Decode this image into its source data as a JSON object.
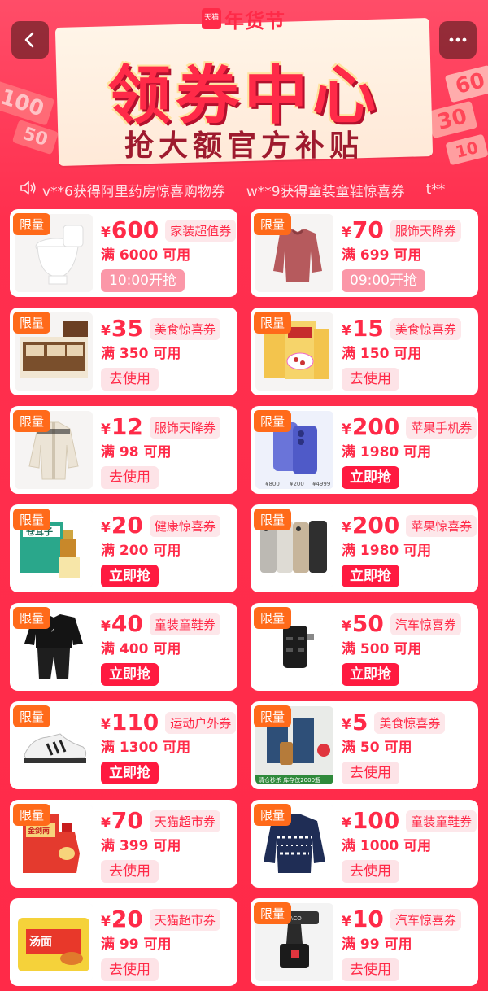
{
  "header": {
    "tmall_seal": "天猫",
    "festival": "年货节",
    "title": "领券中心",
    "subtitle": "抢大额官方补贴",
    "deco_amounts": [
      "100",
      "50",
      "60",
      "30",
      "10"
    ]
  },
  "nav": {
    "back_icon": "chevron-left-icon",
    "more_icon": "more-dots-icon"
  },
  "ticker": [
    "v**6获得阿里药房惊喜购物券",
    "w**9获得童装童鞋惊喜券",
    "t**"
  ],
  "colors": {
    "brand_red": "#ff2a48",
    "limit_tag": "#ff6a1a",
    "card_bg": "#ffffff"
  },
  "coupons": [
    {
      "limit": "限量",
      "currency": "¥",
      "amount": "600",
      "type": "家装超值券",
      "condition": "满 6000 可用",
      "action": "10:00开抢",
      "action_style": "timed",
      "product": "toilet"
    },
    {
      "limit": "限量",
      "currency": "¥",
      "amount": "70",
      "type": "服饰天降券",
      "condition": "满 699 可用",
      "action": "09:00开抢",
      "action_style": "timed",
      "product": "jacket-red"
    },
    {
      "limit": "限量",
      "currency": "¥",
      "amount": "35",
      "type": "美食惊喜券",
      "condition": "满 350 可用",
      "action": "去使用",
      "action_style": "use",
      "product": "snack-box"
    },
    {
      "limit": "限量",
      "currency": "¥",
      "amount": "15",
      "type": "美食惊喜券",
      "condition": "满 150 可用",
      "action": "去使用",
      "action_style": "use",
      "product": "oatmeal"
    },
    {
      "limit": "限量",
      "currency": "¥",
      "amount": "12",
      "type": "服饰天降券",
      "condition": "满 98 可用",
      "action": "去使用",
      "action_style": "use",
      "product": "kids-down-jacket"
    },
    {
      "limit": "限量",
      "currency": "¥",
      "amount": "200",
      "type": "苹果手机券",
      "condition": "满 1980 可用",
      "action": "立即抢",
      "action_style": "grab",
      "product": "iphone-blue"
    },
    {
      "limit": "限量",
      "currency": "¥",
      "amount": "20",
      "type": "健康惊喜券",
      "condition": "满 200 可用",
      "action": "立即抢",
      "action_style": "grab",
      "product": "ear-drops"
    },
    {
      "limit": "限量",
      "currency": "¥",
      "amount": "200",
      "type": "苹果惊喜券",
      "condition": "满 1980 可用",
      "action": "立即抢",
      "action_style": "grab",
      "product": "iphone-pro"
    },
    {
      "limit": "限量",
      "currency": "¥",
      "amount": "40",
      "type": "童装童鞋券",
      "condition": "满 400 可用",
      "action": "立即抢",
      "action_style": "grab",
      "product": "kids-tracksuit"
    },
    {
      "limit": "限量",
      "currency": "¥",
      "amount": "50",
      "type": "汽车惊喜券",
      "condition": "满 500 可用",
      "action": "立即抢",
      "action_style": "grab",
      "product": "car-charger"
    },
    {
      "limit": "限量",
      "currency": "¥",
      "amount": "110",
      "type": "运动户外券",
      "condition": "满 1300 可用",
      "action": "立即抢",
      "action_style": "grab",
      "product": "sneaker"
    },
    {
      "limit": "限量",
      "currency": "¥",
      "amount": "5",
      "type": "美食惊喜券",
      "condition": "满 50 可用",
      "action": "去使用",
      "action_style": "use",
      "product": "liquor-box"
    },
    {
      "limit": "限量",
      "currency": "¥",
      "amount": "70",
      "type": "天猫超市券",
      "condition": "满 399 可用",
      "action": "去使用",
      "action_style": "use",
      "product": "baijiu"
    },
    {
      "limit": "限量",
      "currency": "¥",
      "amount": "100",
      "type": "童装童鞋券",
      "condition": "满 1000 可用",
      "action": "去使用",
      "action_style": "use",
      "product": "kids-sweater"
    },
    {
      "limit": "",
      "currency": "¥",
      "amount": "20",
      "type": "天猫超市券",
      "condition": "满 99 可用",
      "action": "去使用",
      "action_style": "use",
      "product": "instant-noodles"
    },
    {
      "limit": "限量",
      "currency": "¥",
      "amount": "10",
      "type": "汽车惊喜券",
      "condition": "满 99 可用",
      "action": "去使用",
      "action_style": "use",
      "product": "phone-mount"
    }
  ]
}
